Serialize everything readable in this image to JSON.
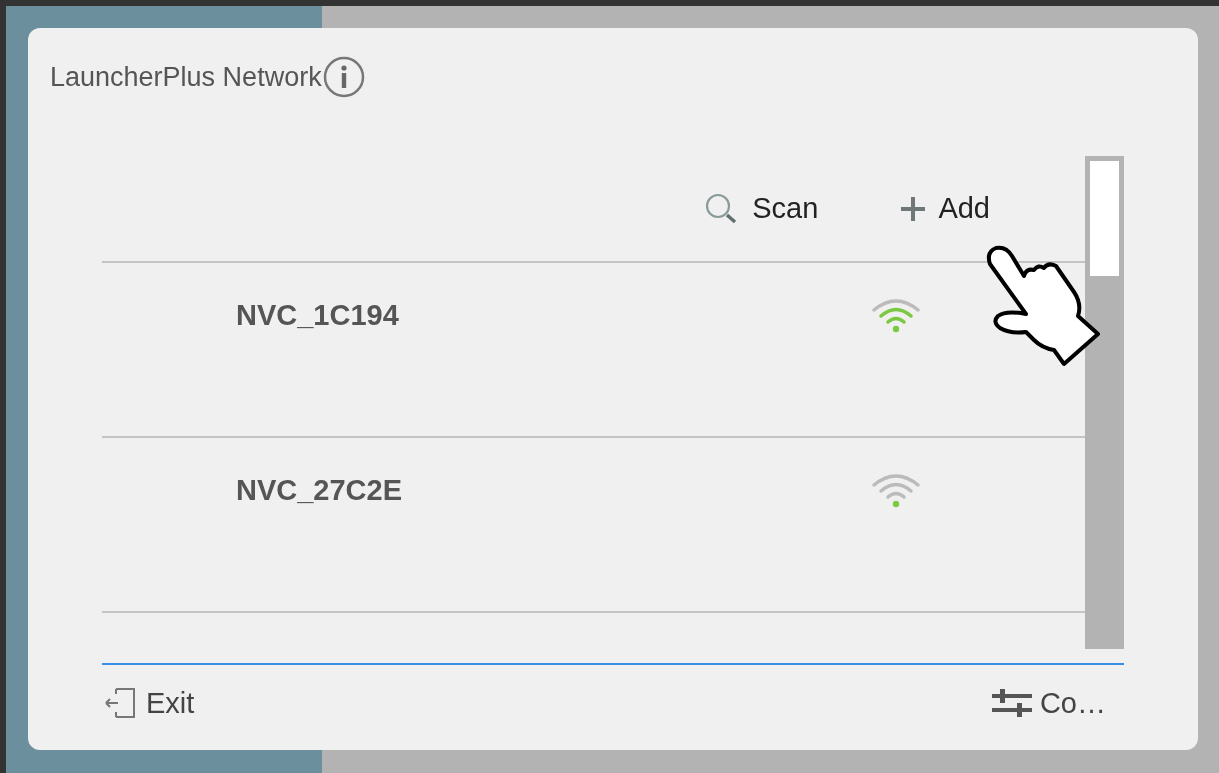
{
  "dialog": {
    "title": "LauncherPlus Network"
  },
  "toolbar": [
    {
      "kind": "scan",
      "label": "Scan"
    },
    {
      "kind": "add",
      "label": "Add"
    }
  ],
  "networks": [
    {
      "name": "NVC_1C194",
      "strong_signal": true
    },
    {
      "name": "NVC_27C2E",
      "strong_signal": false
    }
  ],
  "footer": [
    {
      "kind": "exit",
      "label": "Exit"
    },
    {
      "kind": "settings",
      "label": "Co…"
    }
  ]
}
